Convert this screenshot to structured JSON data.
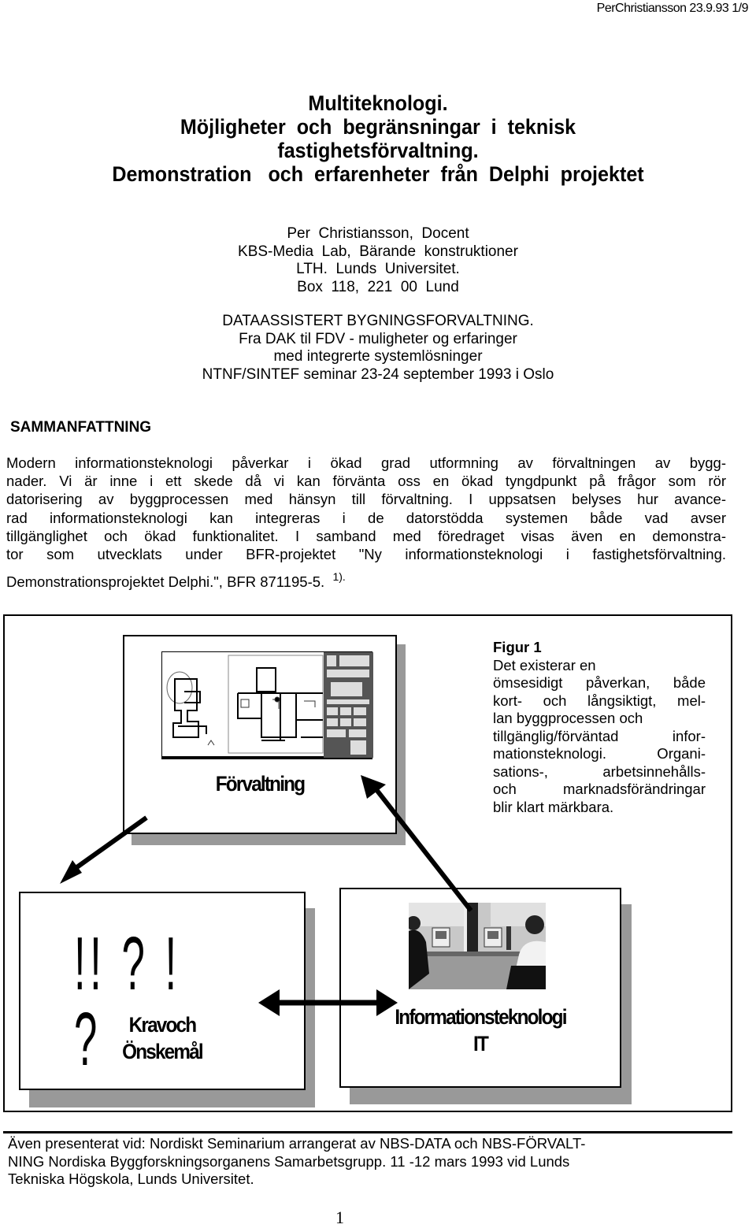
{
  "running_header": "PerChristiansson  23.9.93  1/9",
  "title_lines": [
    "Multiteknologi.",
    "Möjligheter  och  begränsningar  i  teknisk",
    "fastighetsförvaltning.",
    "Demonstration   och  erfarenheter  från  Delphi  projektet"
  ],
  "author_block": [
    "Per  Christiansson,  Docent",
    "KBS-Media  Lab,  Bärande  konstruktioner",
    "LTH.  Lunds  Universitet.",
    "Box  118,  221  00  Lund"
  ],
  "conference_block": [
    "DATAASSISTERT BYGNINGSFORVALTNING.",
    "Fra  DAK  til  FDV  -  muligheter  og  erfaringer",
    "med  integrerte  systemlösninger",
    "NTNF/SINTEF  seminar  23-24  september  1993  i  Oslo"
  ],
  "section_heading": "SAMMANFATTNING",
  "abstract_lines": [
    "Modern informationsteknologi påverkar i ökad grad utformning av förvaltningen av bygg-",
    "nader. Vi är inne i ett skede då vi kan förvänta oss en ökad tyngdpunkt på frågor som rör",
    "datorisering av byggprocessen med hänsyn till förvaltning. I uppsatsen belyses hur avance-",
    "rad  informationsteknologi kan integreras i de datorstödda systemen både vad avser",
    "tillgänglighet och ökad funktionalitet. I samband med föredraget visas även en demonstra-",
    "tor som utvecklats under BFR-projektet \"Ny informationsteknologi i fastighetsförvaltning.",
    "Demonstrationsprojektet  Delphi.\",  BFR  871195-5."
  ],
  "abstract_footnote_ref": "1).",
  "figure": {
    "boxes": {
      "top": "Förvaltning",
      "left_line1": "Kravoch",
      "left_line2": "Önskemål",
      "left_marks": "!! ? !  ?",
      "right_line1": "Informationsteknologi",
      "right_line2": "IT"
    },
    "caption_title": "Figur  1",
    "caption_lines": [
      "Det  existerar  en",
      "ömsesidigt  påverkan,  både",
      "kort-  och  långsiktigt,  mel-",
      "lan byggprocessen  och",
      "tillgänglig/förväntad  infor-",
      "mationsteknologi.  Organi-",
      "sations-,  arbetsinnehålls-",
      "och  marknadsförändringar",
      "blir  klart  märkbara."
    ],
    "images": {
      "top": "floor-plan-cad-screenshot",
      "right": "photo-people-at-computers"
    }
  },
  "footnote_lines": [
    "Även presenterat vid: Nordiskt Seminarium arrangerat av NBS-DATA och NBS-FÖRVALT-",
    "NING Nordiska Byggforskningsorganens Samarbetsgrupp. 11 -12 mars 1993 vid Lunds",
    "Tekniska  Högskola,  Lunds  Universitet."
  ],
  "page_number": "1",
  "colors": {
    "text": "#000000",
    "shadow": "#999999",
    "background": "#ffffff"
  }
}
